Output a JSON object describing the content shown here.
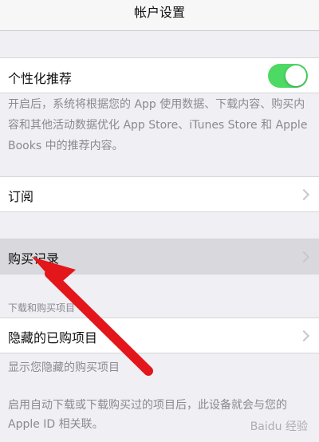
{
  "nav": {
    "title": "帐户设置"
  },
  "personalized": {
    "label": "个性化推荐",
    "enabled": true,
    "description": "开启后，系统将根据您的 App 使用数据、下载内容、购买内容和其他活动数据优化 App Store、iTunes Store 和 Apple Books 中的推荐内容。"
  },
  "subscriptions": {
    "label": "订阅"
  },
  "purchase_history": {
    "label": "购买记录"
  },
  "downloads_section": {
    "header": "下载和购买项目",
    "hidden_purchases": {
      "label": "隐藏的已购项目"
    },
    "hidden_note": "显示您隐藏的购买项目",
    "auto_download_note": "启用自动下载或下载购买过的项目后，此设备就会与您的 Apple ID 相关联。"
  },
  "watermark": "Baidu 经验",
  "colors": {
    "toggle_on": "#4cd964",
    "arrow": "#e3161c",
    "highlight_row": "#d9d9dd"
  }
}
